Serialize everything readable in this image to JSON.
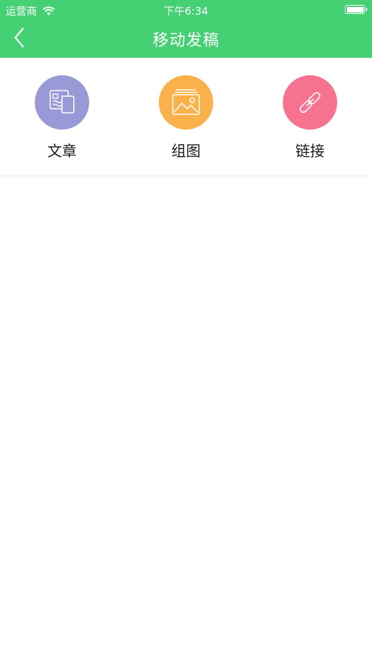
{
  "status_bar": {
    "carrier": "运营商",
    "time": "下午6:34"
  },
  "nav": {
    "title": "移动发稿",
    "back_icon": "chevron-left-icon"
  },
  "actions": [
    {
      "label": "文章",
      "icon": "article-icon",
      "color": "#9899d6"
    },
    {
      "label": "组图",
      "icon": "gallery-icon",
      "color": "#fbb14a"
    },
    {
      "label": "链接",
      "icon": "link-icon",
      "color": "#f7728e"
    }
  ],
  "colors": {
    "header": "#44d073",
    "background": "#ffffff"
  }
}
